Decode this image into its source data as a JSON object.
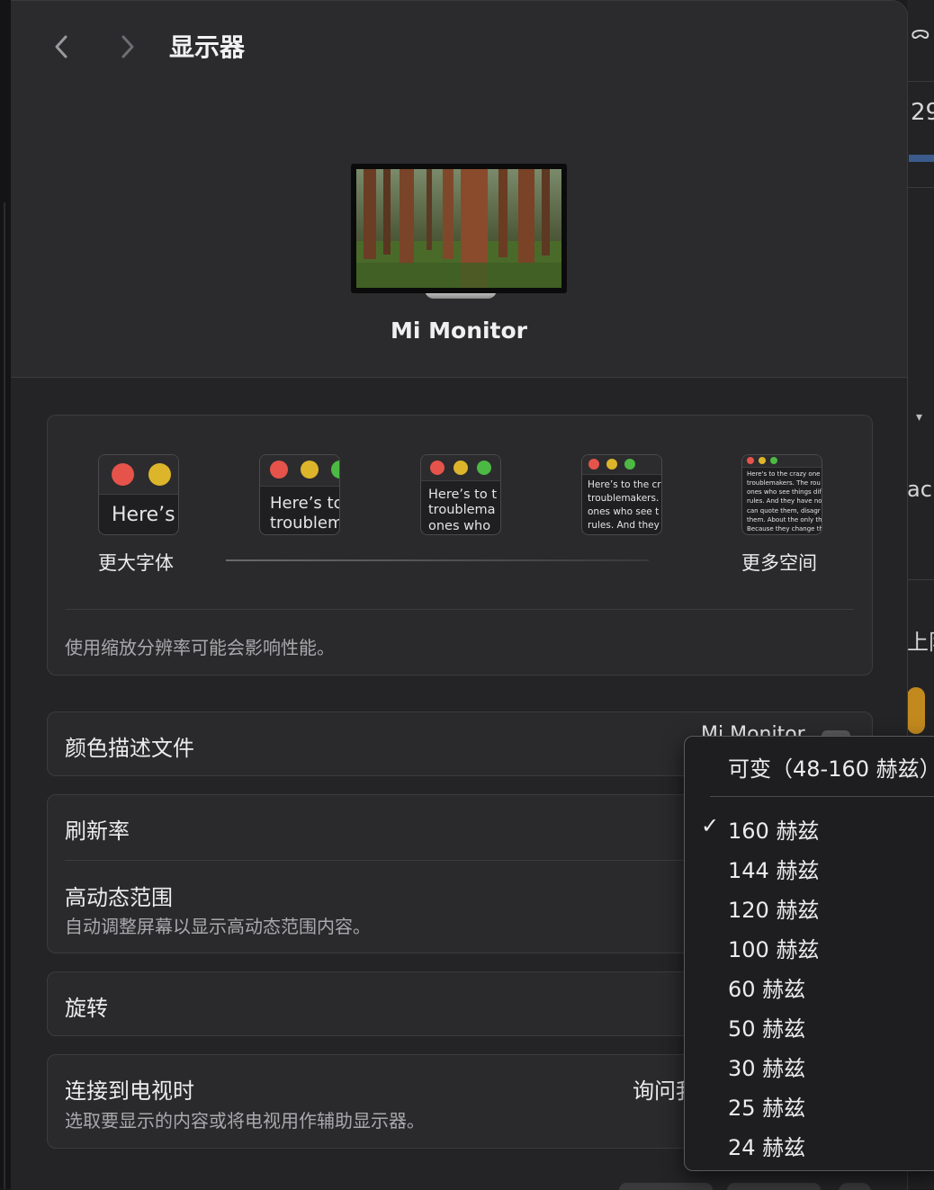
{
  "window": {
    "title": "显示器"
  },
  "monitor": {
    "name": "Mi Monitor"
  },
  "resolution": {
    "label_left": "更大字体",
    "label_right": "更多空间",
    "note": "使用缩放分辨率可能会影响性能。",
    "thumbnails": [
      {
        "text": "Here’s"
      },
      {
        "text": "Here’s to\ntroublem"
      },
      {
        "text": "Here’s to t\ntroublema\nones who"
      },
      {
        "text": "Here’s to the cr\ntroublemakers.\nones who see t\nrules. And they"
      },
      {
        "text": "Here's to the crazy one\ntroublemakers. The rou\nones who see things dif\nrules. And they have no\ncan quote them, disagr\nthem. About the only th\nBecause they change th"
      }
    ]
  },
  "settings": {
    "color_profile": {
      "label": "颜色描述文件",
      "value": "Mi Monitor"
    },
    "refresh_rate": {
      "label": "刷新率"
    },
    "hdr": {
      "label": "高动态范围",
      "sublabel": "自动调整屏幕以显示高动态范围内容。"
    },
    "rotation": {
      "label": "旋转"
    },
    "tv": {
      "label": "连接到电视时",
      "sublabel": "选取要显示的内容或将电视用作辅助显示器。",
      "value": "询问我"
    }
  },
  "refresh_menu": {
    "variable_option": "可变（48-160 赫兹）",
    "checkmark": "✓",
    "selected": "160 赫兹",
    "options": [
      "160 赫兹",
      "144 赫兹",
      "120 赫兹",
      "100 赫兹",
      "60 赫兹",
      "50 赫兹",
      "30 赫兹",
      "25 赫兹",
      "24 赫兹"
    ]
  },
  "background_window": {
    "fragments": [
      "29",
      "ac",
      "上限"
    ]
  },
  "colors": {
    "traffic_red": "#e5534b",
    "traffic_yellow": "#dcb52a",
    "traffic_green": "#4cb944"
  }
}
